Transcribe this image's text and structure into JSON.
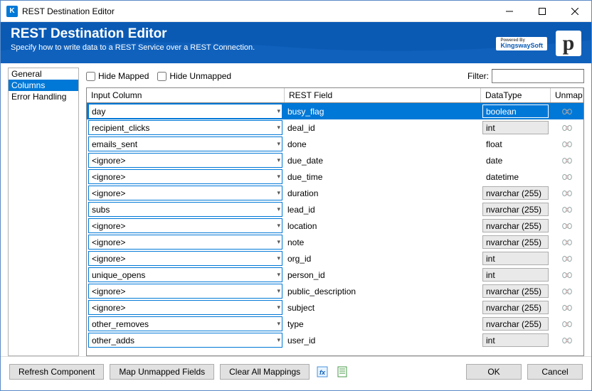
{
  "window": {
    "title": "REST Destination Editor"
  },
  "header": {
    "title": "REST Destination Editor",
    "subtitle": "Specify how to write data to a REST Service over a REST Connection.",
    "powered_by": "Powered By",
    "ks": "KingswaySoft"
  },
  "sidebar": {
    "items": [
      {
        "label": "General",
        "selected": false
      },
      {
        "label": "Columns",
        "selected": true
      },
      {
        "label": "Error Handling",
        "selected": false
      }
    ]
  },
  "toolbar": {
    "hide_mapped": "Hide Mapped",
    "hide_unmapped": "Hide Unmapped",
    "filter_label": "Filter:",
    "filter_value": ""
  },
  "grid": {
    "headers": {
      "input": "Input Column",
      "rest": "REST Field",
      "datatype": "DataType",
      "unmap": "Unmap"
    },
    "rows": [
      {
        "input": "day",
        "rest": "busy_flag",
        "datatype": "boolean",
        "dt_boxed": false,
        "selected": true
      },
      {
        "input": "recipient_clicks",
        "rest": "deal_id",
        "datatype": "int",
        "dt_boxed": true,
        "selected": false
      },
      {
        "input": "emails_sent",
        "rest": "done",
        "datatype": "float",
        "dt_boxed": false,
        "selected": false
      },
      {
        "input": "<ignore>",
        "rest": "due_date",
        "datatype": "date",
        "dt_boxed": false,
        "selected": false
      },
      {
        "input": "<ignore>",
        "rest": "due_time",
        "datatype": "datetime",
        "dt_boxed": false,
        "selected": false
      },
      {
        "input": "<ignore>",
        "rest": "duration",
        "datatype": "nvarchar (255)",
        "dt_boxed": true,
        "selected": false
      },
      {
        "input": "subs",
        "rest": "lead_id",
        "datatype": "nvarchar (255)",
        "dt_boxed": true,
        "selected": false
      },
      {
        "input": "<ignore>",
        "rest": "location",
        "datatype": "nvarchar (255)",
        "dt_boxed": true,
        "selected": false
      },
      {
        "input": "<ignore>",
        "rest": "note",
        "datatype": "nvarchar (255)",
        "dt_boxed": true,
        "selected": false
      },
      {
        "input": "<ignore>",
        "rest": "org_id",
        "datatype": "int",
        "dt_boxed": true,
        "selected": false
      },
      {
        "input": "unique_opens",
        "rest": "person_id",
        "datatype": "int",
        "dt_boxed": true,
        "selected": false
      },
      {
        "input": "<ignore>",
        "rest": "public_description",
        "datatype": "nvarchar (255)",
        "dt_boxed": true,
        "selected": false
      },
      {
        "input": "<ignore>",
        "rest": "subject",
        "datatype": "nvarchar (255)",
        "dt_boxed": true,
        "selected": false
      },
      {
        "input": "other_removes",
        "rest": "type",
        "datatype": "nvarchar (255)",
        "dt_boxed": true,
        "selected": false
      },
      {
        "input": "other_adds",
        "rest": "user_id",
        "datatype": "int",
        "dt_boxed": true,
        "selected": false
      }
    ]
  },
  "footer": {
    "refresh": "Refresh Component",
    "map_unmapped": "Map Unmapped Fields",
    "clear_all": "Clear All Mappings",
    "ok": "OK",
    "cancel": "Cancel"
  }
}
